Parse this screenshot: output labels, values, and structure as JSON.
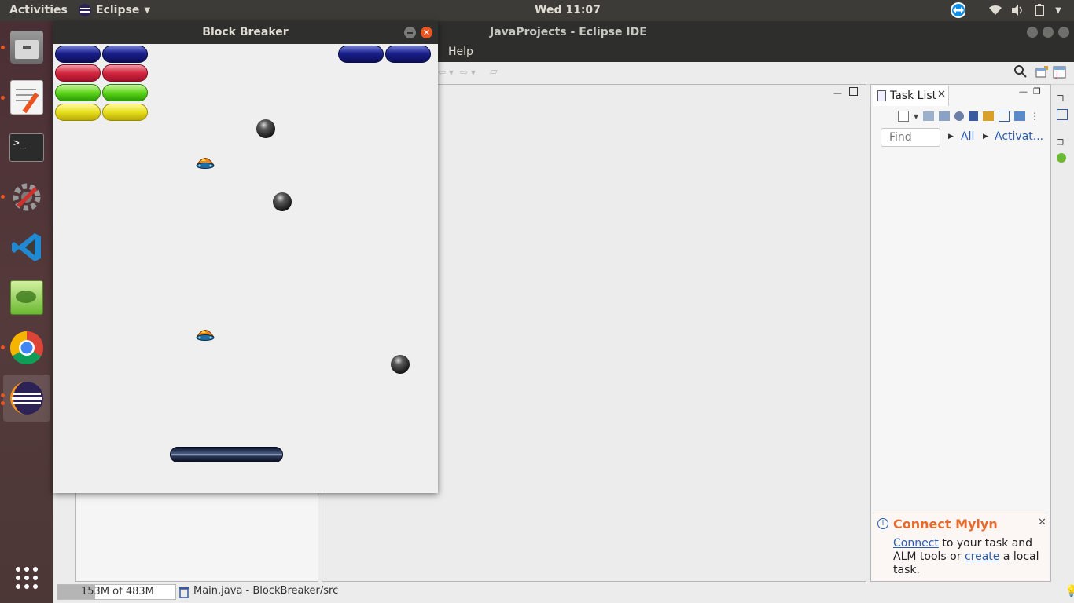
{
  "topbar": {
    "activities": "Activities",
    "app_name": "Eclipse",
    "clock": "Wed 11:07"
  },
  "dock": {
    "items": [
      "files-icon",
      "text-editor-icon",
      "terminal-icon",
      "settings-icon",
      "vscode-icon",
      "image-editor-icon",
      "chrome-icon",
      "eclipse-icon"
    ]
  },
  "eclipse": {
    "title": "JavaProjects - Eclipse IDE",
    "menu": {
      "help": "Help"
    },
    "task_list": {
      "tab_label": "Task List",
      "find_placeholder": "Find",
      "filter_all": "All",
      "filter_activate": "Activat...",
      "mylyn": {
        "title": "Connect Mylyn",
        "connect_link": "Connect",
        "text_1": " to your task and ALM tools or ",
        "create_link": "create",
        "text_2": " a local task."
      }
    },
    "status": {
      "heap": "153M of 483M",
      "heap_fraction": 0.32,
      "file": "Main.java - BlockBreaker/src"
    }
  },
  "game": {
    "title": "Block Breaker"
  },
  "colors": {
    "accent_orange": "#e95420",
    "mylyn_orange": "#e66a2b",
    "link_blue": "#2a5db0"
  }
}
